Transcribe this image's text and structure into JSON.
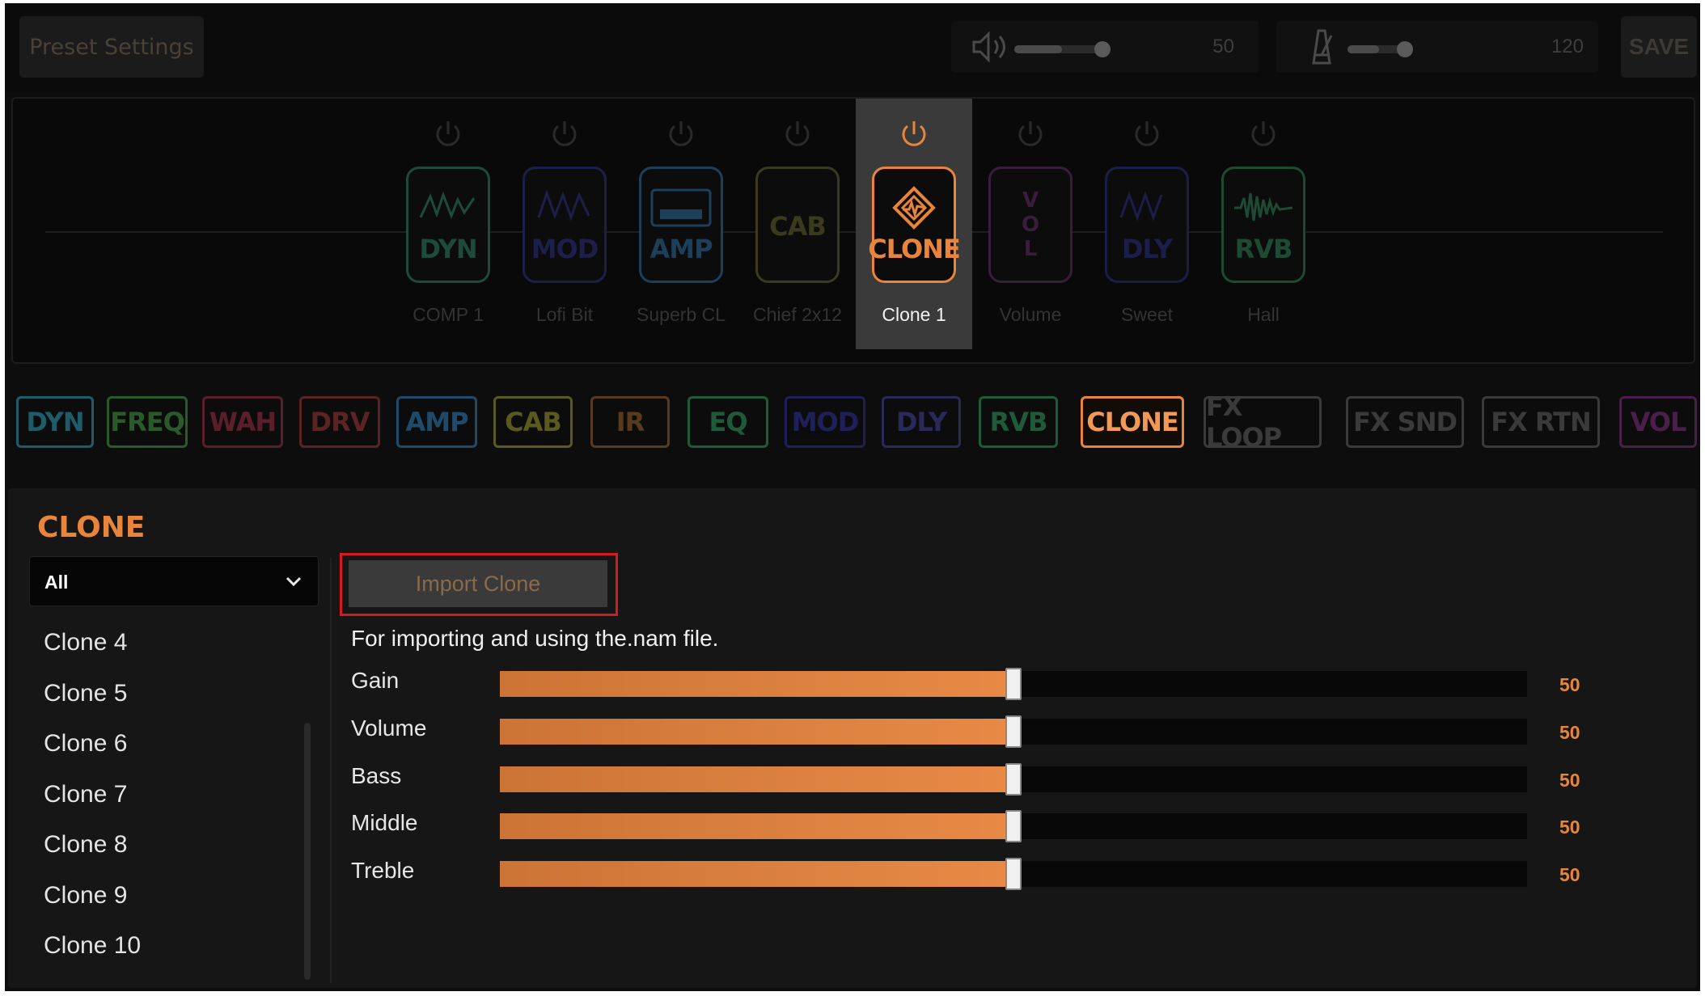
{
  "header": {
    "preset_settings_label": "Preset Settings",
    "volume_value": "50",
    "volume_level": 0.5,
    "tempo_value": "120",
    "tempo_level": 0.5,
    "save_label": "SAVE",
    "volume_icon": "speaker-icon",
    "tempo_icon": "metronome-icon"
  },
  "chain": {
    "blocks": [
      {
        "type": "DYN",
        "name": "COMP 1",
        "color": "#1d4a3a",
        "active": false
      },
      {
        "type": "MOD",
        "name": "Lofi Bit",
        "color": "#1d1f4a",
        "active": false
      },
      {
        "type": "AMP",
        "name": "Superb CL",
        "color": "#1d3f5a",
        "active": false
      },
      {
        "type": "CAB",
        "name": "Chief 2x12",
        "color": "#3a3a1d",
        "active": false
      },
      {
        "type": "CLONE",
        "name": "Clone 1",
        "color": "#e8853a",
        "active": true
      },
      {
        "type": "VOL",
        "name": "Volume",
        "color": "#3a1d3a",
        "active": false
      },
      {
        "type": "DLY",
        "name": "Sweet",
        "color": "#1d1d4a",
        "active": false
      },
      {
        "type": "RVB",
        "name": "Hall",
        "color": "#1d4a33",
        "active": false
      }
    ]
  },
  "categories": [
    {
      "label": "DYN",
      "color": "#1f5c6a"
    },
    {
      "label": "FREQ",
      "color": "#2a5a2a"
    },
    {
      "label": "WAH",
      "color": "#5a1f2a"
    },
    {
      "label": "DRV",
      "color": "#5a2424"
    },
    {
      "label": "AMP",
      "color": "#1f4a6a"
    },
    {
      "label": "CAB",
      "color": "#5a5a1f"
    },
    {
      "label": "IR",
      "color": "#5a3a1f"
    },
    {
      "label": "EQ",
      "color": "#1f5a3a"
    },
    {
      "label": "MOD",
      "color": "#1f1f5a"
    },
    {
      "label": "DLY",
      "color": "#2a2a5a"
    },
    {
      "label": "RVB",
      "color": "#1f5a3a"
    },
    {
      "label": "CLONE",
      "color": "#e8853a"
    },
    {
      "label": "FX LOOP",
      "color": "#3a3a3a"
    },
    {
      "label": "FX SND",
      "color": "#3a3a3a"
    },
    {
      "label": "FX RTN",
      "color": "#3a3a3a"
    },
    {
      "label": "VOL",
      "color": "#4a1f4a"
    }
  ],
  "panel": {
    "title": "CLONE",
    "filter_value": "All",
    "import_button_label": "Import Clone",
    "hint": "For importing and using the.nam file.",
    "clones": [
      "Clone 4",
      "Clone 5",
      "Clone 6",
      "Clone 7",
      "Clone 8",
      "Clone 9",
      "Clone 10"
    ],
    "params": [
      {
        "label": "Gain",
        "value": "50",
        "level": 0.5
      },
      {
        "label": "Volume",
        "value": "50",
        "level": 0.5
      },
      {
        "label": "Bass",
        "value": "50",
        "level": 0.5
      },
      {
        "label": "Middle",
        "value": "50",
        "level": 0.5
      },
      {
        "label": "Treble",
        "value": "50",
        "level": 0.5
      }
    ]
  },
  "colors": {
    "accent": "#e8853a",
    "highlight_border": "#d71920"
  }
}
